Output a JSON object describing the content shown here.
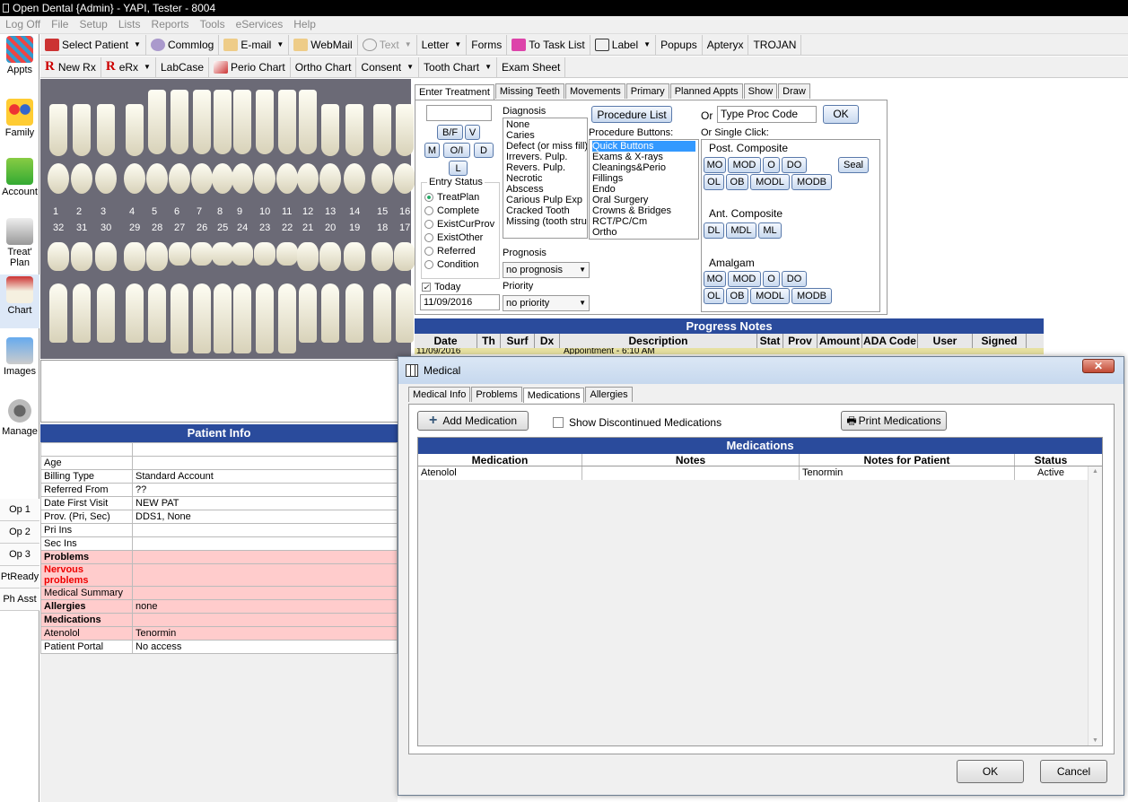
{
  "window": {
    "title": "Open Dental {Admin} - YAPI, Tester - 8004"
  },
  "menu": [
    "Log Off",
    "File",
    "Setup",
    "Lists",
    "Reports",
    "Tools",
    "eServices",
    "Help"
  ],
  "toolbar1": {
    "select_patient": "Select Patient",
    "commlog": "Commlog",
    "email": "E-mail",
    "webmail": "WebMail",
    "text": "Text",
    "letter": "Letter",
    "forms": "Forms",
    "task_list": "To Task List",
    "label": "Label",
    "popups": "Popups",
    "apteryx": "Apteryx",
    "trojan": "TROJAN"
  },
  "toolbar2": {
    "new_rx": "New Rx",
    "erx": "eRx",
    "labcase": "LabCase",
    "perio_chart": "Perio Chart",
    "ortho_chart": "Ortho Chart",
    "consent": "Consent",
    "tooth_chart": "Tooth Chart",
    "exam_sheet": "Exam Sheet"
  },
  "nav": [
    "Appts",
    "Family",
    "Account",
    "Treat' Plan",
    "Chart",
    "Images",
    "Manage"
  ],
  "ops": [
    "Op 1",
    "Op 2",
    "Op 3",
    "PtReady",
    "Ph Asst"
  ],
  "teeth": {
    "upper_numbers": [
      "1",
      "2",
      "3",
      "4",
      "5",
      "6",
      "7",
      "8",
      "9",
      "10",
      "11",
      "12",
      "13",
      "14",
      "15",
      "16"
    ],
    "lower_numbers": [
      "32",
      "31",
      "30",
      "29",
      "28",
      "27",
      "26",
      "25",
      "24",
      "23",
      "22",
      "21",
      "20",
      "19",
      "18",
      "17"
    ]
  },
  "patient_info": {
    "title": "Patient Info",
    "rows": [
      {
        "k": "",
        "v": ""
      },
      {
        "k": "Age",
        "v": ""
      },
      {
        "k": "Billing Type",
        "v": "Standard Account"
      },
      {
        "k": "Referred From",
        "v": "??"
      },
      {
        "k": "Date First Visit",
        "v": "NEW PAT"
      },
      {
        "k": "Prov. (Pri, Sec)",
        "v": "DDS1, None"
      },
      {
        "k": "Pri Ins",
        "v": ""
      },
      {
        "k": "Sec Ins",
        "v": ""
      }
    ],
    "problems": "Problems",
    "nervous": "Nervous problems",
    "medical_summary": "Medical Summary",
    "allergies_k": "Allergies",
    "allergies_v": "none",
    "medications": "Medications",
    "med_k": "Atenolol",
    "med_v": "Tenormin",
    "portal_k": "Patient Portal",
    "portal_v": "No access"
  },
  "treatment": {
    "tabs": [
      "Enter Treatment",
      "Missing Teeth",
      "Movements",
      "Primary",
      "Planned Appts",
      "Show",
      "Draw"
    ],
    "surf": [
      "B/F",
      "V",
      "M",
      "O/I",
      "D",
      "L"
    ],
    "entry_status_label": "Entry Status",
    "statuses": [
      "TreatPlan",
      "Complete",
      "ExistCurProv",
      "ExistOther",
      "Referred",
      "Condition"
    ],
    "today": "Today",
    "date": "11/09/2016",
    "diagnosis_label": "Diagnosis",
    "diagnoses": [
      "None",
      "Caries",
      "Defect (or miss fill)",
      "Irrevers. Pulp.",
      "Revers. Pulp.",
      "Necrotic",
      "Abscess",
      "Carious Pulp Exp",
      "Cracked Tooth",
      "Missing (tooth struc"
    ],
    "prognosis_label": "Prognosis",
    "prognosis": "no prognosis",
    "priority_label": "Priority",
    "priority": "no priority",
    "proc_list": "Procedure List",
    "proc_buttons_label": "Procedure Buttons:",
    "proc_buttons": [
      "Quick Buttons",
      "Exams & X-rays",
      "Cleanings&Perio",
      "Fillings",
      "Endo",
      "Oral Surgery",
      "Crowns & Bridges",
      "RCT/PC/Cm",
      "Ortho"
    ],
    "or": "Or",
    "proc_code": "Type Proc Code",
    "ok": "OK",
    "single_click": "Or Single Click:",
    "post_comp": "Post. Composite",
    "ant_comp": "Ant. Composite",
    "amalgam": "Amalgam",
    "seal": "Seal",
    "pc_row1": [
      "MO",
      "MOD",
      "O",
      "DO"
    ],
    "pc_row2": [
      "OL",
      "OB",
      "MODL",
      "MODB"
    ],
    "ac_row": [
      "DL",
      "MDL",
      "ML"
    ],
    "am_row1": [
      "MO",
      "MOD",
      "O",
      "DO"
    ],
    "am_row2": [
      "OL",
      "OB",
      "MODL",
      "MODB"
    ]
  },
  "progress": {
    "title": "Progress Notes",
    "cols": [
      "Date",
      "Th",
      "Surf",
      "Dx",
      "Description",
      "Stat",
      "Prov",
      "Amount",
      "ADA Code",
      "User",
      "Signed"
    ],
    "row_date": "11/09/2016",
    "row_desc": "Appointment - 6:10 AM"
  },
  "dialog": {
    "title": "Medical",
    "tabs": [
      "Medical Info",
      "Problems",
      "Medications",
      "Allergies"
    ],
    "add": "Add Medication",
    "show_disc": "Show Discontinued Medications",
    "print": "Print Medications",
    "grid_title": "Medications",
    "cols": [
      "Medication",
      "Notes",
      "Notes for Patient",
      "Status"
    ],
    "rows": [
      {
        "medication": "Atenolol",
        "notes": "",
        "notes_patient": "Tenormin",
        "status": "Active"
      }
    ],
    "ok": "OK",
    "cancel": "Cancel"
  }
}
